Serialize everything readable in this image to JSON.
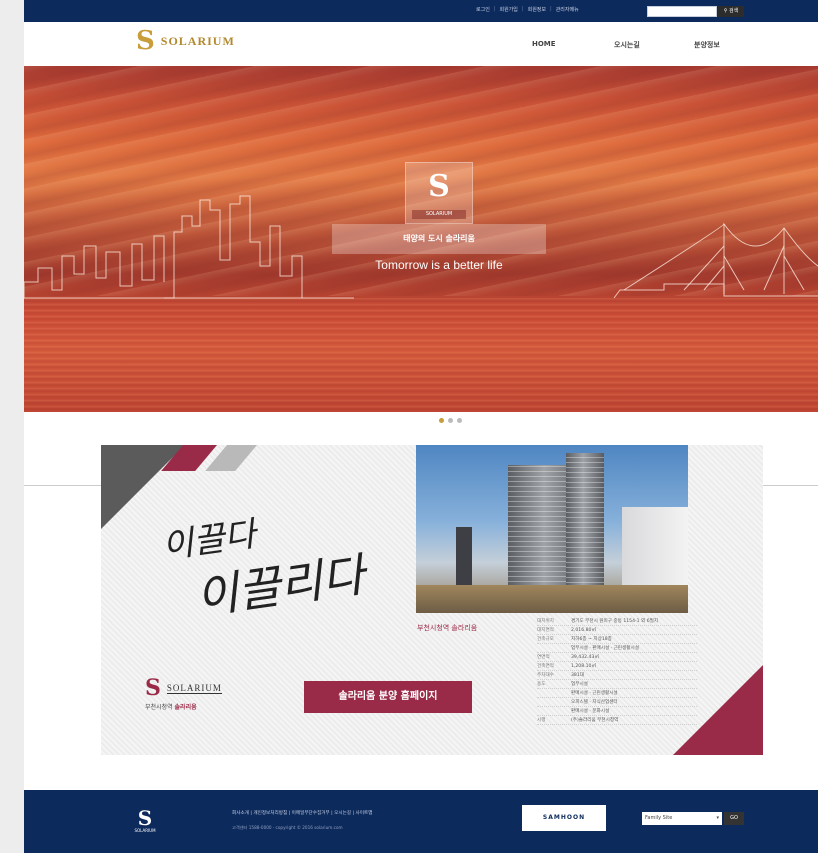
{
  "topbar": {
    "links": [
      "로그인",
      "회원가입",
      "회원정보",
      "관리자메뉴"
    ],
    "search_button": "검색"
  },
  "header": {
    "logo_text": "SOLARIUM",
    "nav": [
      "HOME",
      "오시는길",
      "분양정보"
    ]
  },
  "hero": {
    "logo_text": "SOLARIUM",
    "caption": "태양의 도시 솔라리움",
    "tagline": "Tomorrow is a better life",
    "slides": 3,
    "active_slide": 1
  },
  "promo": {
    "calligraphy_line1": "이끌다",
    "calligraphy_line2": "이끌리다",
    "photo_caption": "부천시청역 솔라리움",
    "logo_text": "SOLARIUM",
    "logo_sub_prefix": "부천시청역",
    "logo_sub_name": "솔라리움",
    "cta": "솔라리움 분양 홈페이지",
    "specs": [
      {
        "k": "대지위치",
        "v": "경기도 부천시 원미구 중동 1154-1 외 6필지"
      },
      {
        "k": "대지면적",
        "v": "2,016.80㎡"
      },
      {
        "k": "건축규모",
        "v": "지하6층 ~ 지상18층"
      },
      {
        "k": "",
        "v": "업무시설 · 판매시설 · 근린생활시설"
      },
      {
        "k": "연면적",
        "v": "39,432.43㎡"
      },
      {
        "k": "건축면적",
        "v": "1,208.10㎡"
      },
      {
        "k": "주차대수",
        "v": "381대"
      },
      {
        "k": "용도",
        "v": "업무시설"
      },
      {
        "k": "",
        "v": "판매시설 · 근린생활시설"
      },
      {
        "k": "",
        "v": "오피스텔 · 지식산업센터"
      },
      {
        "k": "",
        "v": "판매시설 · 문화시설"
      },
      {
        "k": "시행",
        "v": "(주)솔라리움 부천시청역"
      }
    ]
  },
  "footer": {
    "logo_text": "SOLARIUM",
    "links": "회사소개 | 개인정보처리방침 | 이메일무단수집거부 | 오시는길 | 사이트맵",
    "copyright": "고객센터 1588-0000 · copyright © 2016 solarium.com",
    "brand": "SAMHOON",
    "family_site": "Family Site",
    "go": "GO"
  },
  "colors": {
    "navy": "#0d2a5c",
    "gold": "#c89d3a",
    "burgundy": "#9a2b48"
  }
}
